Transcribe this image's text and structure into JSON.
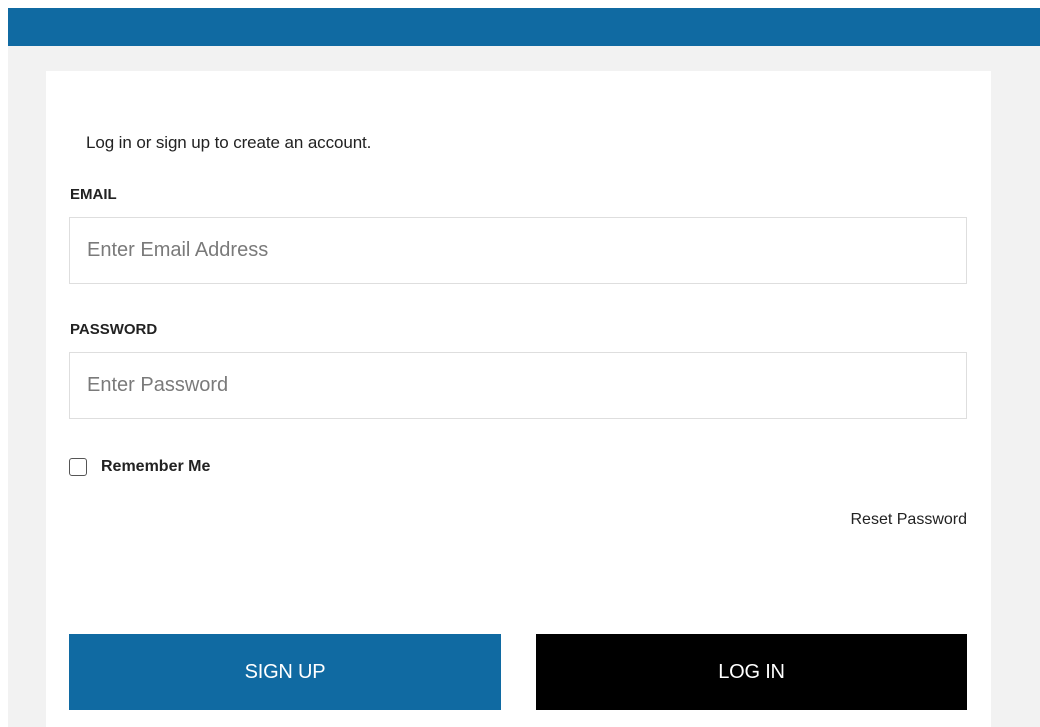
{
  "intro_text": "Log in or sign up to create an account.",
  "email": {
    "label": "EMAIL",
    "placeholder": "Enter Email Address",
    "value": ""
  },
  "password": {
    "label": "PASSWORD",
    "placeholder": "Enter Password",
    "value": ""
  },
  "remember_me": {
    "label": "Remember Me",
    "checked": false
  },
  "reset_password_label": "Reset Password",
  "buttons": {
    "sign_up": "SIGN UP",
    "log_in": "LOG IN"
  },
  "colors": {
    "brand_blue": "#106aa2",
    "login_black": "#000000",
    "backdrop_gray": "#f2f2f2"
  }
}
